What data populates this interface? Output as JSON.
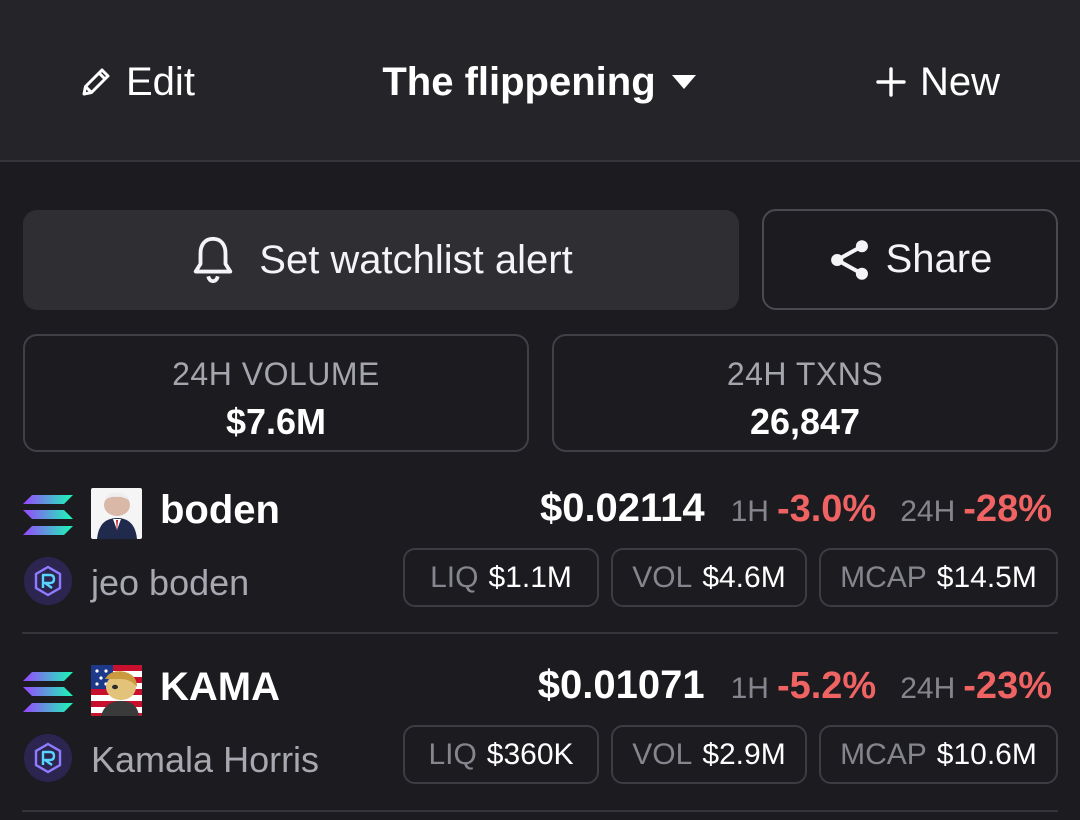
{
  "header": {
    "edit_label": "Edit",
    "watchlist_title": "The flippening",
    "new_label": "New"
  },
  "actions": {
    "alert_label": "Set watchlist alert",
    "share_label": "Share"
  },
  "stats": [
    {
      "label": "24H VOLUME",
      "value": "$7.6M"
    },
    {
      "label": "24H TXNS",
      "value": "26,847"
    }
  ],
  "tokens": [
    {
      "symbol": "boden",
      "name": "jeo boden",
      "price": "$0.02114",
      "change_1h_label": "1H",
      "change_1h": "-3.0%",
      "change_24h_label": "24H",
      "change_24h": "-28%",
      "liq_label": "LIQ",
      "liq": "$1.1M",
      "vol_label": "VOL",
      "vol": "$4.6M",
      "mcap_label": "MCAP",
      "mcap": "$14.5M"
    },
    {
      "symbol": "KAMA",
      "name": "Kamala Horris",
      "price": "$0.01071",
      "change_1h_label": "1H",
      "change_1h": "-5.2%",
      "change_24h_label": "24H",
      "change_24h": "-23%",
      "liq_label": "LIQ",
      "liq": "$360K",
      "vol_label": "VOL",
      "vol": "$2.9M",
      "mcap_label": "MCAP",
      "mcap": "$10.6M"
    }
  ],
  "icons": {
    "edit": "pencil-icon",
    "title_dropdown": "caret-down-icon",
    "new": "plus-icon",
    "alert": "bell-icon",
    "share": "share-icon",
    "chain": "solana-icon",
    "dex": "raydium-icon"
  },
  "colors": {
    "background": "#1b1b20",
    "header_bg": "#252529",
    "negative": "#ef6363",
    "muted": "#85858d"
  }
}
